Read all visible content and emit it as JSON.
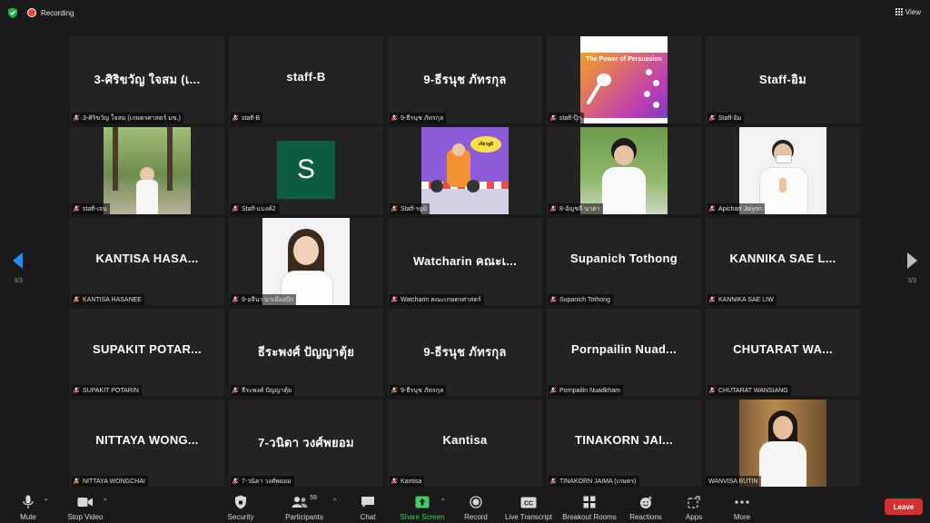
{
  "top": {
    "recording": "Recording",
    "view": "View"
  },
  "tiles": [
    {
      "big": "3-ศิริขวัญ ใจสม (เ...",
      "label": "3-ศิริขวัญ ใจสม (เกษตรศาสตร์ มข.)"
    },
    {
      "big": "staff-B",
      "label": "staff-B"
    },
    {
      "big": "9-ธีรนุช  ภัทรกุล",
      "label": "9-ธีรนุช  ภัทรกุล"
    },
    {
      "big": "",
      "label": "staff-ปุ๊ก",
      "image": "The Power of Persuasion"
    },
    {
      "big": "Staff-อิม",
      "label": "Staff-อิม"
    },
    {
      "big": "",
      "label": "staff-เจน"
    },
    {
      "big": "",
      "label": "Staff-แบงค์2",
      "avatar": "S"
    },
    {
      "big": "",
      "label": "Staff-รยูมิ",
      "image": "เจ้ยรยูมิ"
    },
    {
      "big": "",
      "label": "8-อัญชลี นาคา"
    },
    {
      "big": "",
      "label": "Apichart Jaiyon"
    },
    {
      "big": "KANTISA  HASA...",
      "label": "KANTISA HASANEE"
    },
    {
      "big": "",
      "label": "9-อลีนา มาเมืองปัก"
    },
    {
      "big": "Watcharin  คณะเ...",
      "label": "Watcharin คณะเกษตรศาสตร์"
    },
    {
      "big": "Supanich  Tothong",
      "label": "Supanich Tothong"
    },
    {
      "big": "KANNIKA  SAE  L...",
      "label": "KANNIKA SAE LIW"
    },
    {
      "big": "SUPAKIT  POTAR...",
      "label": "SUPAKIT POTARIN"
    },
    {
      "big": "ธีระพงศ์  ปัญญาตุ้ย",
      "label": "ธีระพงศ์ ปัญญาตุ้ย"
    },
    {
      "big": "9-ธีรนุช  ภัทรกุล",
      "label": "9-ธีรนุช  ภัทรกุล"
    },
    {
      "big": "Pornpailin  Nuad...",
      "label": "Pornpailin Nuadkham"
    },
    {
      "big": "CHUTARAT  WA...",
      "label": "CHUTARAT WANSIANG"
    },
    {
      "big": "NITTAYA  WONG...",
      "label": "NITTAYA WONGCHAI"
    },
    {
      "big": "7-วนิดา  วงศ์พยอม",
      "label": "7-วนิดา  วงศ์พยอม"
    },
    {
      "big": "Kantisa",
      "label": "Kantisa"
    },
    {
      "big": "TINAKORN  JAI...",
      "label": "TINAKORN JAIMA (เกษตร)"
    },
    {
      "big": "",
      "label": "WANVISA BUTIN"
    }
  ],
  "nav": {
    "left_page": "3/3",
    "right_page": "3/3"
  },
  "toolbar": {
    "mute": "Mute",
    "stop_video": "Stop Video",
    "security": "Security",
    "participants": "Participants",
    "participants_count": "59",
    "chat": "Chat",
    "share_screen": "Share Screen",
    "record": "Record",
    "live_transcript": "Live Transcript",
    "breakout_rooms": "Breakout Rooms",
    "reactions": "Reactions",
    "apps": "Apps",
    "more": "More",
    "leave": "Leave"
  },
  "colors": {
    "accent_green": "#3ecf5e",
    "leave_red": "#d62f2f",
    "avatar_green": "#0b5c42",
    "recording_red": "#e8453c"
  }
}
